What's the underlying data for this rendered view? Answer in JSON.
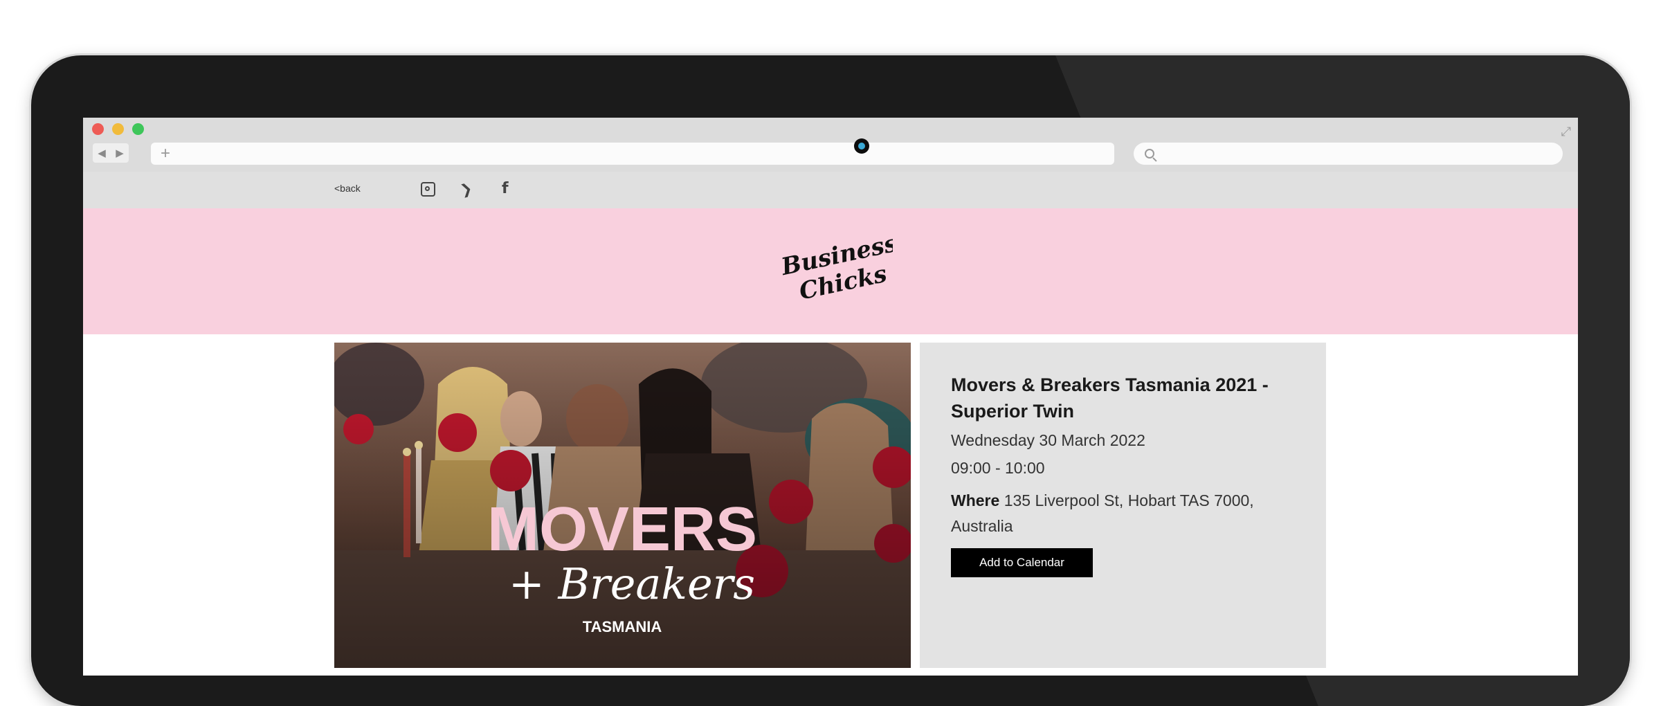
{
  "browser": {
    "nav_back": "◀",
    "nav_forward": "▶",
    "url_plus": "+",
    "expand": "⤢"
  },
  "topbar": {
    "back_label": "<back",
    "socials": [
      "instagram-icon",
      "twitter-icon",
      "facebook-icon"
    ],
    "twitter_glyph": "❯",
    "facebook_glyph": "f"
  },
  "brand": {
    "logo_line1": "Business",
    "logo_line2": "Chicks",
    "header_color": "#f9d0de"
  },
  "image_overlay": {
    "title": "MOVERS",
    "subtitle": "+ Breakers",
    "location": "TASMANIA"
  },
  "event": {
    "title": "Movers & Breakers Tasmania 2021 - Superior Twin",
    "date": "Wednesday 30 March 2022",
    "time": "09:00 - 10:00",
    "where_label": "Where",
    "where_value": "135 Liverpool St, Hobart TAS 7000, Australia",
    "calendar_button": "Add to Calendar"
  }
}
